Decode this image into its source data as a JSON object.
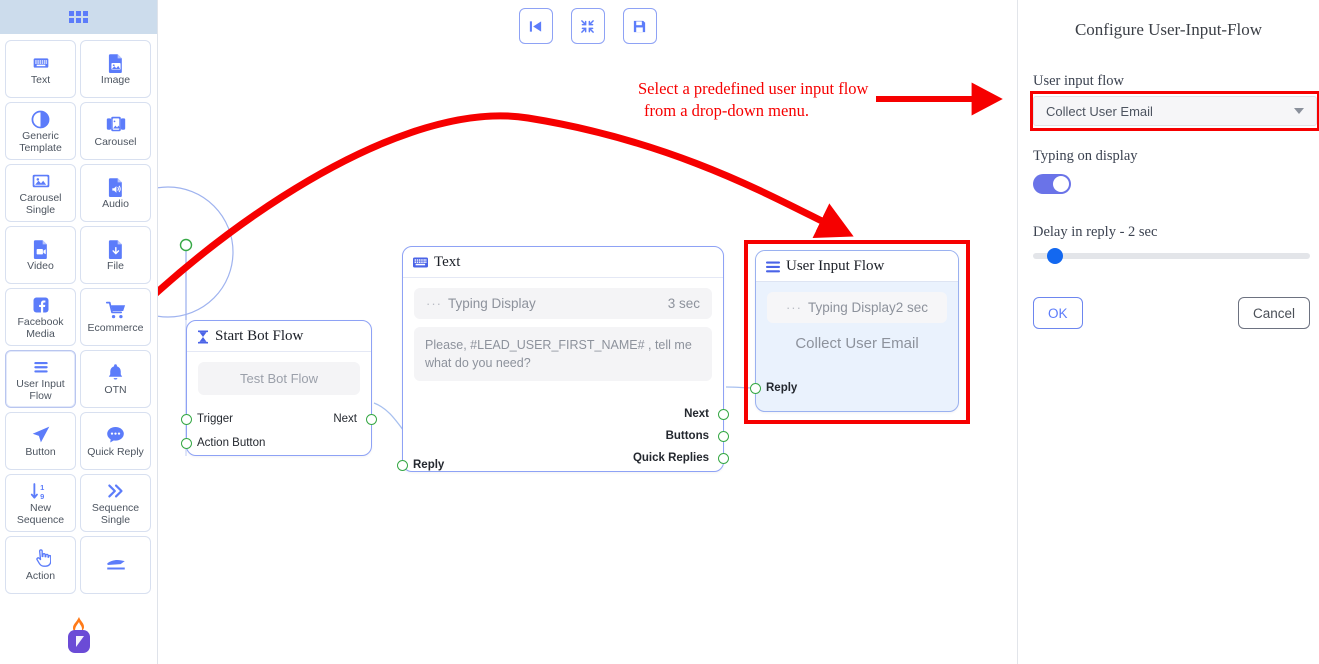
{
  "sidebar": {
    "header_icon": "grid-icon",
    "items": [
      {
        "label": "Text",
        "icon": "keyboard-icon"
      },
      {
        "label": "Image",
        "icon": "image-file-icon"
      },
      {
        "label": "Generic Template",
        "icon": "half-circle-icon"
      },
      {
        "label": "Carousel",
        "icon": "carousel-icon"
      },
      {
        "label": "Carousel Single",
        "icon": "single-image-icon"
      },
      {
        "label": "Audio",
        "icon": "audio-file-icon"
      },
      {
        "label": "Video",
        "icon": "video-file-icon"
      },
      {
        "label": "File",
        "icon": "download-file-icon"
      },
      {
        "label": "Facebook Media",
        "icon": "facebook-icon"
      },
      {
        "label": "Ecommerce",
        "icon": "shopping-cart-icon"
      },
      {
        "label": "User Input Flow",
        "icon": "hamburger-lines-icon"
      },
      {
        "label": "OTN",
        "icon": "bell-icon"
      },
      {
        "label": "Button",
        "icon": "send-arrow-icon"
      },
      {
        "label": "Quick Reply",
        "icon": "chat-bubble-icon"
      },
      {
        "label": "New Sequence",
        "icon": "sort-numeric-icon"
      },
      {
        "label": "Sequence Single",
        "icon": "double-chevron-right-icon"
      },
      {
        "label": "Action",
        "icon": "pointing-hand-icon"
      },
      {
        "label": "",
        "icon": "paper-plane-icon"
      }
    ],
    "logo": "flame-bot-logo"
  },
  "toolbar": {
    "buttons": [
      {
        "name": "skip-to-start-button",
        "icon": "skip-back-icon"
      },
      {
        "name": "fit-to-screen-button",
        "icon": "compress-arrows-icon"
      },
      {
        "name": "save-button",
        "icon": "floppy-disk-icon"
      }
    ]
  },
  "annotation": {
    "line1": "Select a predefined user input flow",
    "line2": "from a drop-down menu.",
    "color": "#f60000"
  },
  "canvas": {
    "nodes": [
      {
        "id": "start",
        "title": "Start Bot Flow",
        "icon": "hourglass-icon",
        "button_label": "Test Bot Flow",
        "ports_left": [
          "Trigger",
          "Action Button"
        ],
        "ports_right": [
          "Next"
        ]
      },
      {
        "id": "text",
        "title": "Text",
        "icon": "keyboard-icon",
        "typing_label": "Typing Display",
        "typing_value": "3 sec",
        "message": "Please, #LEAD_USER_FIRST_NAME# , tell me what do you need?",
        "ports_left": [
          "Reply"
        ],
        "ports_right": [
          "Next",
          "Buttons",
          "Quick Replies"
        ]
      },
      {
        "id": "user-input-flow",
        "title": "User Input Flow",
        "icon": "hamburger-lines-icon",
        "typing_label": "Typing Display2 sec",
        "flow_name": "Collect User Email",
        "ports_left": [
          "Reply"
        ],
        "ports_right": []
      }
    ]
  },
  "panel": {
    "title": "Configure User-Input-Flow",
    "flow_field_label": "User input flow",
    "flow_selected": "Collect User Email",
    "typing_label": "Typing on display",
    "typing_enabled": true,
    "delay_label": "Delay in reply  -  2 sec",
    "delay_percent": 6,
    "ok_label": "OK",
    "cancel_label": "Cancel",
    "accent_toggle": "#6a73e8",
    "accent_slider": "#1368f0",
    "highlight_color": "#f60000"
  }
}
